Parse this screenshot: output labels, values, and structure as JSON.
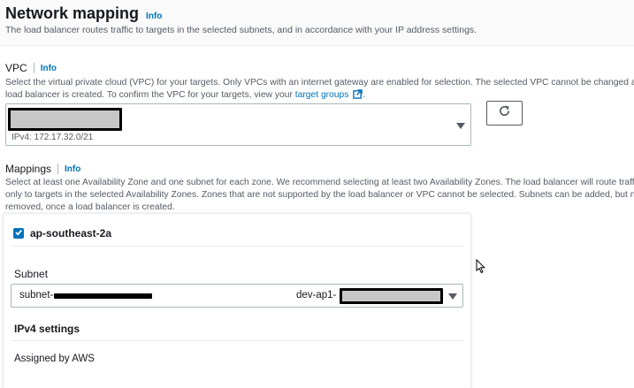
{
  "network": {
    "title": "Network mapping",
    "info": "Info",
    "description": "The load balancer routes traffic to targets in the selected subnets, and in accordance with your IP address settings."
  },
  "vpc": {
    "label": "VPC",
    "info": "Info",
    "desc_line1": "Select the virtual private cloud (VPC) for your targets. Only VPCs with an internet gateway are enabled for selection. The selected VPC cannot be changed after the",
    "desc_line2_prefix": "load balancer is created. To confirm the VPC for your targets, view your ",
    "desc_link": "target groups",
    "desc_line2_suffix": ".",
    "selected_sublabel": "IPv4: 172.17.32.0/21"
  },
  "mappings": {
    "label": "Mappings",
    "info": "Info",
    "desc_line1": "Select at least one Availability Zone and one subnet for each zone. We recommend selecting at least two Availability Zones. The load balancer will route traffic",
    "desc_line2": "only to targets in the selected Availability Zones. Zones that are not supported by the load balancer or VPC cannot be selected. Subnets can be added, but not",
    "desc_line3": "removed, once a load balancer is created."
  },
  "zone": {
    "name": "ap-southeast-2a",
    "checked": true,
    "subnet_label": "Subnet",
    "subnet_prefix": "subnet-",
    "subnet_name_prefix": "dev-ap1-",
    "ipv4_settings_label": "IPv4 settings",
    "ipv4_value": "Assigned by AWS"
  },
  "colors": {
    "accent": "#0073bb",
    "border": "#aab7b8",
    "text": "#16191f",
    "muted": "#545b64"
  },
  "icons": [
    "external-link-icon",
    "refresh-icon",
    "caret-down-icon",
    "checkmark-icon",
    "mouse-cursor-icon"
  ]
}
